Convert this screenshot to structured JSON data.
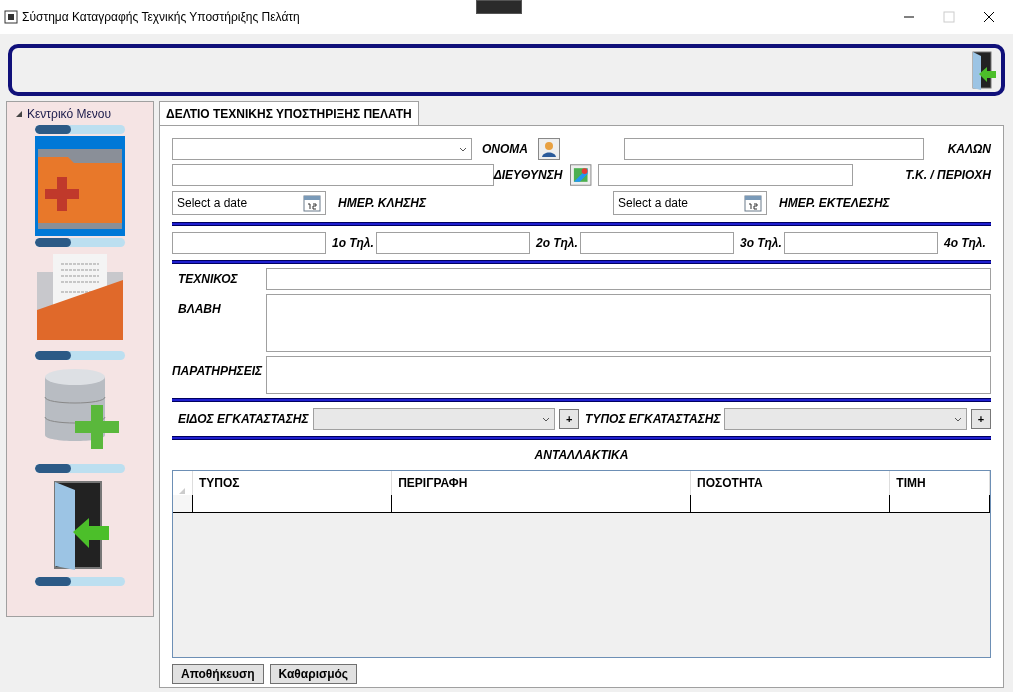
{
  "window": {
    "title": "Σύστημα Καταγραφής Τεχνικής Υποστήριξης Πελάτη"
  },
  "sidebar": {
    "title": "Κεντρικό Μενου",
    "expanded": true,
    "items": [
      {
        "kind": "new-folder",
        "selected": true,
        "level": 0.4
      },
      {
        "kind": "document-folder",
        "selected": false,
        "level": 0.4
      },
      {
        "kind": "database-add",
        "selected": false,
        "level": 0.4
      },
      {
        "kind": "exit",
        "selected": false,
        "level": 0.4
      }
    ]
  },
  "tabs": [
    {
      "label": "ΔΕΛΤΙΟ ΤΕΧΝΙΚΗΣ ΥΠΟΣΤΗΡΙΞΗΣ ΠΕΛΑΤΗ",
      "selected": true
    }
  ],
  "form": {
    "name_label": "ΟΝΟΜΑ",
    "surname_label": "ΚΑΛΩΝ",
    "address_label": "ΔΙΕΥΘΥΝΣΗ",
    "postcode_label": "Τ.Κ. / ΠΕΡΙΟΧΗ",
    "call_date": {
      "placeholder": "Select a date",
      "label": "ΗΜΕΡ. ΚΛΗΣΗΣ"
    },
    "exec_date": {
      "placeholder": "Select a date",
      "label": "ΗΜΕΡ. ΕΚΤΕΛΕΣΗΣ"
    },
    "phones": [
      "1ο Τηλ.",
      "2ο Τηλ.",
      "3ο Τηλ.",
      "4ο Τηλ."
    ],
    "technician_label": "ΤΕΧΝΙΚΟΣ",
    "fault_label": "ΒΛΑΒΗ",
    "notes_label": "ΠΑΡΑΤΗΡΗΣΕΙΣ",
    "install_kind_label": "ΕΙΔΟΣ ΕΓΚΑΤΑΣΤΑΣΗΣ",
    "install_type_label": "ΤΥΠΟΣ ΕΓΚΑΤΑΣΤΑΣΗΣ",
    "add_button": "+"
  },
  "parts": {
    "title": "ΑΝΤΑΛΛΑΚΤΙΚΑ",
    "columns": [
      "ΤΥΠΟΣ",
      "ΠΕΡΙΓΡΑΦΗ",
      "ΠΟΣΟΤΗΤΑ",
      "ΤΙΜΗ"
    ]
  },
  "buttons": [
    "Αποθήκευση",
    "Καθαρισμός"
  ]
}
